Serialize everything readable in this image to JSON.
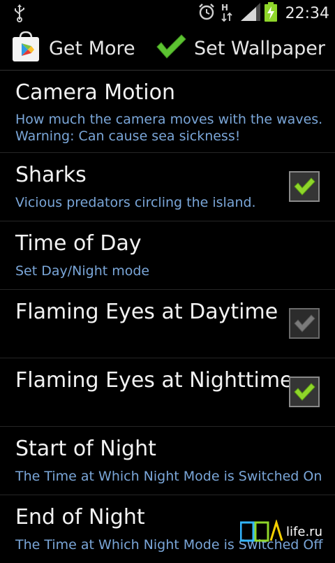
{
  "status_bar": {
    "time": "22:34",
    "icons": [
      "usb-icon",
      "alarm-icon",
      "data-transfer-icon",
      "signal-icon",
      "battery-charging-icon"
    ]
  },
  "action_bar": {
    "get_more_label": "Get More",
    "set_wallpaper_label": "Set Wallpaper"
  },
  "settings": [
    {
      "title": "Camera Motion",
      "summary_line1": "How much the camera moves with the waves.",
      "summary_line2": "Warning: Can cause sea sickness!"
    },
    {
      "title": "Sharks",
      "summary": "Vicious predators circling the island.",
      "checked": true,
      "enabled": true
    },
    {
      "title": "Time of Day",
      "summary": "Set Day/Night mode"
    },
    {
      "title": "Flaming Eyes at Daytime",
      "checked": true,
      "enabled": false
    },
    {
      "title": "Flaming Eyes at Nighttime",
      "checked": true,
      "enabled": true
    },
    {
      "title": "Start of Night",
      "summary": "The Time at Which Night Mode is Switched On"
    },
    {
      "title": "End of Night",
      "summary": "The Time at Which Night Mode is Switched Off"
    }
  ],
  "watermark": {
    "logo_text": "PDA",
    "text": "life.ru"
  },
  "colors": {
    "summary_text": "#7aa6d8",
    "check_green": "#8fd62a",
    "check_disabled": "#7a7a7a"
  }
}
